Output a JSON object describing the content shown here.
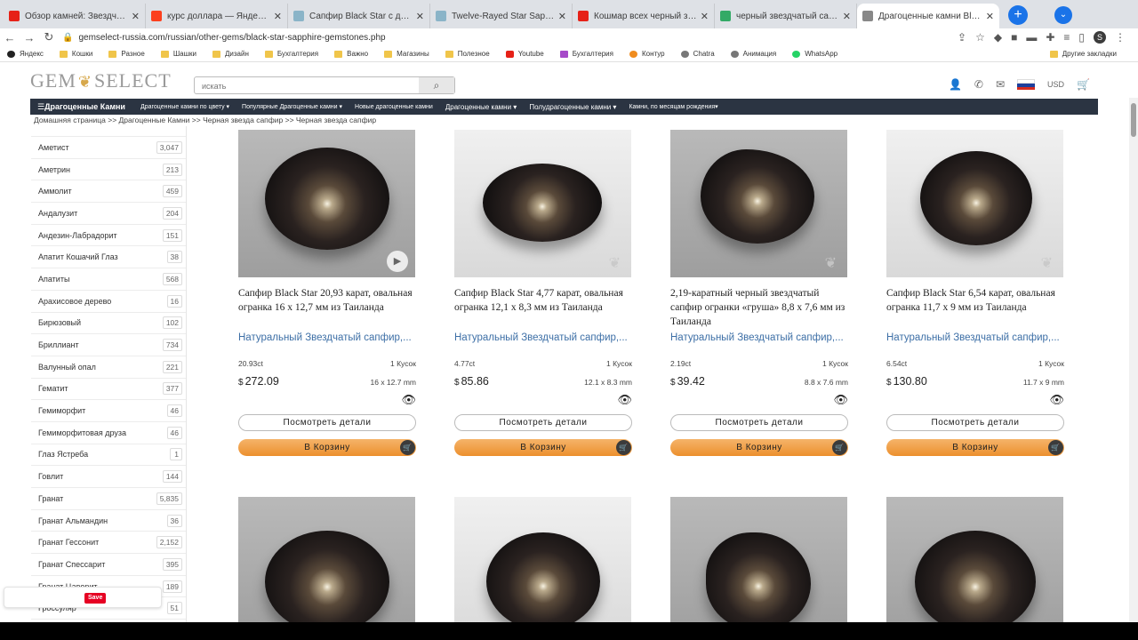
{
  "browser": {
    "tabs": [
      {
        "title": "Обзор камней: Звездчатые сап",
        "color": "#e62117",
        "active": false
      },
      {
        "title": "курс доллара — Яндекс: нашел",
        "color": "#fc3f1d",
        "active": false
      },
      {
        "title": "Сапфир Black Star с двойной от",
        "color": "#8ab4c8",
        "active": false
      },
      {
        "title": "Twelve-Rayed Star Sapphire from",
        "color": "#8ab4c8",
        "active": false
      },
      {
        "title": "Кошмар всех черный звездчати",
        "color": "#e62117",
        "active": false
      },
      {
        "title": "черный звездчатый сапфир - A",
        "color": "#33aa66",
        "active": false
      },
      {
        "title": "Драгоценные камни Black Star",
        "color": "#888888",
        "active": true
      }
    ],
    "url": "gemselect-russia.com/russian/other-gems/black-star-sapphire-gemstones.php",
    "profile_initial": "S",
    "bookmarks": [
      {
        "label": "Яндекс",
        "icon": "blk"
      },
      {
        "label": "Кошки",
        "icon": "folder"
      },
      {
        "label": "Разное",
        "icon": "folder"
      },
      {
        "label": "Шашки",
        "icon": "folder"
      },
      {
        "label": "Дизайн",
        "icon": "folder"
      },
      {
        "label": "Бухгалтерия",
        "icon": "folder"
      },
      {
        "label": "Важно",
        "icon": "folder"
      },
      {
        "label": "Магазины",
        "icon": "folder"
      },
      {
        "label": "Полезное",
        "icon": "folder"
      },
      {
        "label": "Youtube",
        "icon": "yt"
      },
      {
        "label": "Бухгалтерия",
        "icon": "purple"
      },
      {
        "label": "Контур",
        "icon": "orange"
      },
      {
        "label": "Chatra",
        "icon": "gray"
      },
      {
        "label": "Анимация",
        "icon": "gray"
      },
      {
        "label": "WhatsApp",
        "icon": "green"
      }
    ],
    "other_bookmarks": "Другие закладки"
  },
  "site": {
    "logo_left": "GEM",
    "logo_right": "SELECT",
    "search_placeholder": "искать",
    "currency": "USD",
    "nav": {
      "main": "Драгоценные Камни",
      "items": [
        "Драгоценные камни по цвету ▾",
        "Популярные Драгоценные камни ▾",
        "Новые драгоценные камни",
        "Драгоценные камни ▾",
        "Полудрагоценные камни ▾",
        "Камни, по месяцам рождения▾"
      ]
    },
    "breadcrumb": "Домашняя страница >> Драгоценные Камни >> Черная звезда сапфир >> Черная звезда сапфир"
  },
  "sidebar": {
    "categories": [
      {
        "name": "Аметист",
        "count": "3,047"
      },
      {
        "name": "Аметрин",
        "count": "213"
      },
      {
        "name": "Аммолит",
        "count": "459"
      },
      {
        "name": "Андалузит",
        "count": "204"
      },
      {
        "name": "Андезин-Лабрадорит",
        "count": "151"
      },
      {
        "name": "Апатит Кошачий Глаз",
        "count": "38"
      },
      {
        "name": "Апатиты",
        "count": "568"
      },
      {
        "name": "Арахисовое дерево",
        "count": "16"
      },
      {
        "name": "Бирюзовый",
        "count": "102"
      },
      {
        "name": "Бриллиант",
        "count": "734"
      },
      {
        "name": "Валунный опал",
        "count": "221"
      },
      {
        "name": "Гематит",
        "count": "377"
      },
      {
        "name": "Гемиморфит",
        "count": "46"
      },
      {
        "name": "Гемиморфитовая друза",
        "count": "46"
      },
      {
        "name": "Глаз Ястреба",
        "count": "1"
      },
      {
        "name": "Говлит",
        "count": "144"
      },
      {
        "name": "Гранат",
        "count": "5,835"
      },
      {
        "name": "Гранат Альмандин",
        "count": "36"
      },
      {
        "name": "Гранат Гессонит",
        "count": "2,152"
      },
      {
        "name": "Гранат Спессарит",
        "count": "395"
      },
      {
        "name": "Гранат Цаворит",
        "count": "189"
      },
      {
        "name": "Гроссуляр",
        "count": "51"
      }
    ]
  },
  "products": [
    {
      "title": "Сапфир Black Star 20,93 карат, овальная огранка 16 x 12,7 мм из Таиланда",
      "subtitle": "Натуральный Звездчатый сапфир,...",
      "weight": "20.93ct",
      "qty": "1 Кусок",
      "currency": "$",
      "price": "272.09",
      "dims": "16 x 12.7 mm",
      "details_label": "Посмотреть детали",
      "cart_label": "В Корзину",
      "has_video": true
    },
    {
      "title": "Сапфир Black Star 4,77 карат, овальная огранка 12,1 x 8,3 мм из Таиланда",
      "subtitle": "Натуральный Звездчатый сапфир,...",
      "weight": "4.77ct",
      "qty": "1 Кусок",
      "currency": "$",
      "price": "85.86",
      "dims": "12.1 x 8.3 mm",
      "details_label": "Посмотреть детали",
      "cart_label": "В Корзину",
      "has_video": false
    },
    {
      "title": "2,19-каратный черный звездчатый сапфир огранки «груша» 8,8 x 7,6 мм из Таиланда",
      "subtitle": "Натуральный Звездчатый сапфир,...",
      "weight": "2.19ct",
      "qty": "1 Кусок",
      "currency": "$",
      "price": "39.42",
      "dims": "8.8 x 7.6 mm",
      "details_label": "Посмотреть детали",
      "cart_label": "В Корзину",
      "has_video": false
    },
    {
      "title": "Сапфир Black Star 6,54 карат, овальная огранка 11,7 x 9 мм из Таиланда",
      "subtitle": "Натуральный Звездчатый сапфир,...",
      "weight": "6.54ct",
      "qty": "1 Кусок",
      "currency": "$",
      "price": "130.80",
      "dims": "11.7 x 9 mm",
      "details_label": "Посмотреть детали",
      "cart_label": "В Корзину",
      "has_video": false
    }
  ],
  "widgets": {
    "save_label": "Save"
  }
}
